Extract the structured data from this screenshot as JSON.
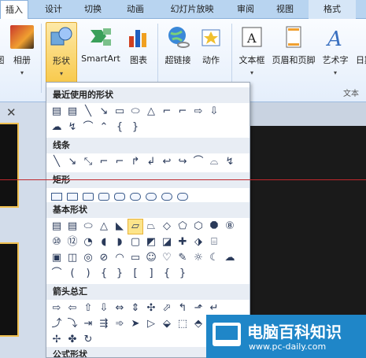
{
  "tabs": [
    "插入",
    "设计",
    "切换",
    "动画",
    "幻灯片放映",
    "审阅",
    "视图",
    "格式"
  ],
  "ribbon": {
    "buttons": [
      {
        "label": "相册",
        "icon": "photo-album-icon",
        "dropdown": "▾"
      },
      {
        "label": "形状",
        "icon": "shapes-icon",
        "dropdown": "▾"
      },
      {
        "label": "SmartArt",
        "icon": "smartart-icon"
      },
      {
        "label": "图表",
        "icon": "chart-icon"
      },
      {
        "label": "超链接",
        "icon": "hyperlink-icon"
      },
      {
        "label": "动作",
        "icon": "action-icon"
      },
      {
        "label": "文本框",
        "icon": "textbox-icon",
        "dropdown": "▾"
      },
      {
        "label": "页眉和页脚",
        "icon": "header-footer-icon"
      },
      {
        "label": "艺术字",
        "icon": "wordart-icon",
        "dropdown": "▾"
      },
      {
        "label": "日期",
        "icon": "date-time-icon"
      }
    ],
    "left_cut_label": "图",
    "group_label": "文本"
  },
  "dropdown": {
    "sections": [
      {
        "title": "最近使用的形状",
        "rows": [
          [
            "▤",
            "▤",
            "╲",
            "↘",
            "▭",
            "⬭",
            "△",
            "⌐",
            "⌐",
            "⇨",
            "⇩"
          ],
          [
            "☁",
            "↯",
            "⌒",
            "⌃",
            "{",
            "}"
          ]
        ]
      },
      {
        "title": "线条",
        "rows": [
          [
            "╲",
            "↘",
            "⤡",
            "⌐",
            "⌐",
            "↱",
            "↲",
            "↩",
            "↪",
            "⌒",
            "⌓",
            "↯"
          ]
        ]
      },
      {
        "title": "矩形",
        "rows": [
          [
            "▭",
            "▭",
            "▭",
            "▭",
            "▭",
            "▭",
            "▭",
            "▭",
            "▭"
          ]
        ]
      },
      {
        "title": "基本形状",
        "rows": [
          [
            "▤",
            "▤",
            "⬭",
            "△",
            "◣",
            "▱",
            "⏢",
            "◇",
            "⬠",
            "⬡",
            "⯃",
            "⑧"
          ],
          [
            "⑩",
            "⑫",
            "◔",
            "◖",
            "◗",
            "▢",
            "◩",
            "◪",
            "✚",
            "⬗",
            "⌸"
          ],
          [
            "▣",
            "◫",
            "◎",
            "⊘",
            "◠",
            "▭",
            "☺",
            "♡",
            "✎",
            "☼",
            "☾",
            "☁"
          ],
          [
            "⌒",
            "(",
            ")",
            "{",
            "}",
            "[",
            "]",
            "{",
            "}"
          ]
        ]
      },
      {
        "title": "箭头总汇",
        "rows": [
          [
            "⇨",
            "⇦",
            "⇧",
            "⇩",
            "⇔",
            "⇕",
            "✣",
            "⬀",
            "↰",
            "⬏",
            "↵"
          ],
          [
            "⤴",
            "⤵",
            "⇥",
            "⇶",
            "➾",
            "➤",
            "▷",
            "⬙",
            "⬚",
            "⬘",
            "⬛"
          ],
          [
            "✢",
            "✤",
            "↻"
          ]
        ]
      },
      {
        "title": "公式形状",
        "rows": []
      }
    ]
  },
  "watermark": {
    "title": "电脑百科知识",
    "url": "www.pc-daily.com"
  },
  "left_panel": {
    "close_glyph": "✕"
  },
  "colors": {
    "accent": "#f8c94a",
    "brand": "#1f86c8",
    "line": "#c0282d"
  }
}
